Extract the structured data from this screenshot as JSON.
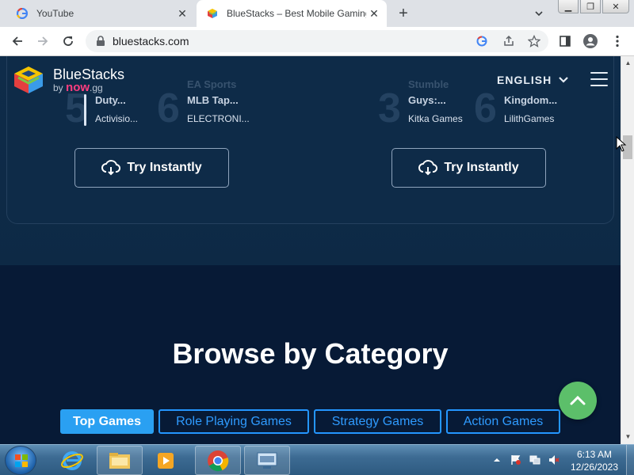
{
  "browser": {
    "tabs": [
      {
        "title": "YouTube",
        "favicon": "google-g-icon",
        "active": false
      },
      {
        "title": "BlueStacks – Best Mobile Gaming",
        "favicon": "bluestacks-icon",
        "active": true
      }
    ],
    "address": "bluestacks.com",
    "window_buttons": [
      "minimize",
      "restore",
      "close"
    ]
  },
  "site": {
    "logo_text": "BlueStacks",
    "logo_by": "by",
    "logo_now": "now",
    "logo_gg": ".gg",
    "language": "ENGLISH",
    "games": [
      {
        "rank": "5",
        "dev_top": "",
        "name": "Duty...",
        "developer": "Activisio..."
      },
      {
        "rank": "6",
        "dev_top": "EA Sports",
        "name": "MLB Tap...",
        "developer": "ELECTRONI..."
      },
      {
        "rank": "3",
        "dev_top": "Stumble",
        "name": "Guys:...",
        "developer": "Kitka Games"
      },
      {
        "rank": "6",
        "dev_top": "",
        "name": "Kingdom...",
        "developer": "LilithGames"
      }
    ],
    "try_buttons": [
      "Try Instantly",
      "Try Instantly"
    ],
    "browse_title": "Browse by Category",
    "categories": [
      {
        "label": "Top Games",
        "active": true
      },
      {
        "label": "Role Playing Games",
        "active": false
      },
      {
        "label": "Strategy Games",
        "active": false
      },
      {
        "label": "Action Games",
        "active": false
      }
    ],
    "colors": {
      "accent": "#2496ff",
      "fab": "#5cbf6a",
      "now_pink": "#ff3d7f"
    }
  },
  "taskbar": {
    "time": "6:13 AM",
    "date": "12/26/2023",
    "apps": [
      "internet-explorer-icon",
      "file-explorer-icon",
      "media-player-icon",
      "chrome-icon",
      "keyboard-icon"
    ]
  }
}
